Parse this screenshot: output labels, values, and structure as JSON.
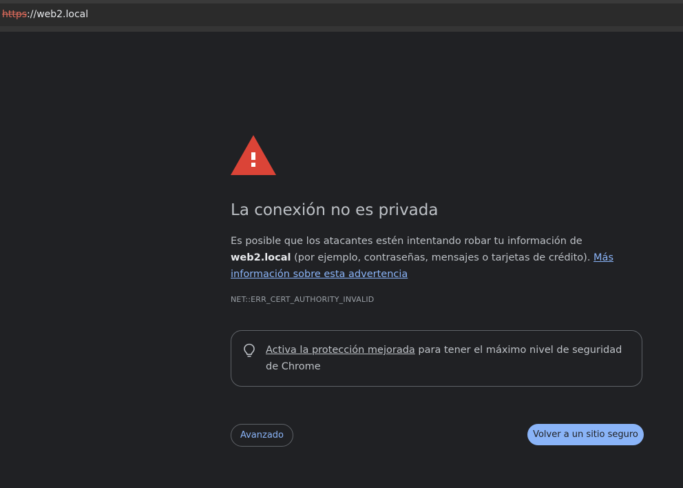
{
  "browser": {
    "url_scheme": "https",
    "url_rest": "://web2.local"
  },
  "interstitial": {
    "icon": "warning-triangle-icon",
    "title": "La conexión no es privada",
    "desc_pre": "Es posible que los atacantes estén intentando robar tu información de ",
    "desc_host": "web2.local",
    "desc_post": " (por ejemplo, contraseñas, mensajes o tarjetas de crédito). ",
    "desc_link": "Más información sobre esta advertencia",
    "error_code": "NET::ERR_CERT_AUTHORITY_INVALID",
    "protection": {
      "icon": "lightbulb-icon",
      "link": "Activa la protección mejorada",
      "text": " para tener el máximo nivel de seguridad de Chrome"
    },
    "advanced_label": "Avanzado",
    "back_label": "Volver a un sitio seguro"
  },
  "colors": {
    "background": "#202124",
    "warning_red": "#db4437",
    "link_blue": "#8ab4f8",
    "primary_button": "#8ab4f8"
  }
}
